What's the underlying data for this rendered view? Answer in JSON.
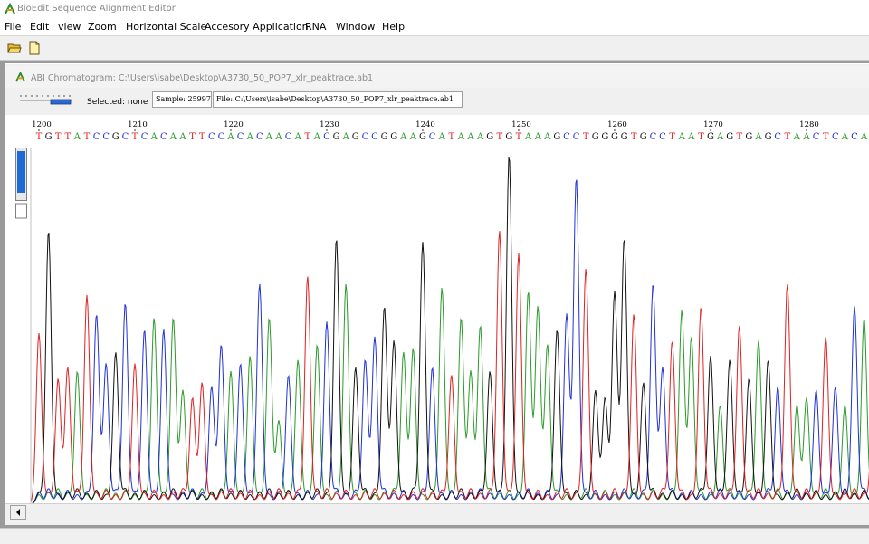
{
  "app": {
    "title": "BioEdit Sequence Alignment Editor"
  },
  "menu": [
    "File",
    "Edit",
    "view",
    "Zoom",
    "Horizontal Scale",
    "Accesory Application",
    "RNA",
    "Window",
    "Help"
  ],
  "child_window": {
    "title": "ABI Chromatogram: C:\\Users\\isabe\\Desktop\\A3730_50_POP7_xlr_peaktrace.ab1",
    "selected_label": "Selected: none",
    "sample_box": "Sample: 25997",
    "file_box": "File: C:\\Users\\isabe\\Desktop\\A3730_50_POP7_xlr_peaktrace.ab1"
  },
  "ruler": {
    "start": 1200,
    "step": 10,
    "labels": [
      "1200",
      "1210",
      "1220",
      "1230",
      "1240",
      "1250",
      "1260",
      "1270",
      "1280"
    ]
  },
  "sequence": "TGTTATCCGCTCACAATTCCACACAACATACGAGCCGGAAGCATAAAGTGTAAAGCCTGGGGTGCCTAATGAGTGAGCTAACTCACAT",
  "colors": {
    "A": "#2a9a2a",
    "C": "#2030d8",
    "G": "#111111",
    "T": "#e02020"
  },
  "trace_peaks": [
    0.45,
    0.72,
    0.33,
    0.36,
    0.35,
    0.55,
    0.5,
    0.37,
    0.4,
    0.53,
    0.37,
    0.46,
    0.49,
    0.46,
    0.49,
    0.3,
    0.28,
    0.32,
    0.31,
    0.42,
    0.35,
    0.37,
    0.39,
    0.58,
    0.49,
    0.22,
    0.34,
    0.38,
    0.6,
    0.42,
    0.48,
    0.7,
    0.58,
    0.36,
    0.38,
    0.44,
    0.52,
    0.43,
    0.4,
    0.41,
    0.69,
    0.36,
    0.57,
    0.34,
    0.49,
    0.35,
    0.47,
    0.35,
    0.72,
    0.92,
    0.66,
    0.56,
    0.52,
    0.42,
    0.46,
    0.5,
    0.86,
    0.62,
    0.3,
    0.28,
    0.56,
    0.7,
    0.5,
    0.32,
    0.58,
    0.36,
    0.43,
    0.51,
    0.44,
    0.52,
    0.39,
    0.26,
    0.38,
    0.47,
    0.33,
    0.43,
    0.38,
    0.31,
    0.58,
    0.26,
    0.28,
    0.3,
    0.44,
    0.31,
    0.26,
    0.52,
    0.49,
    0.29
  ]
}
